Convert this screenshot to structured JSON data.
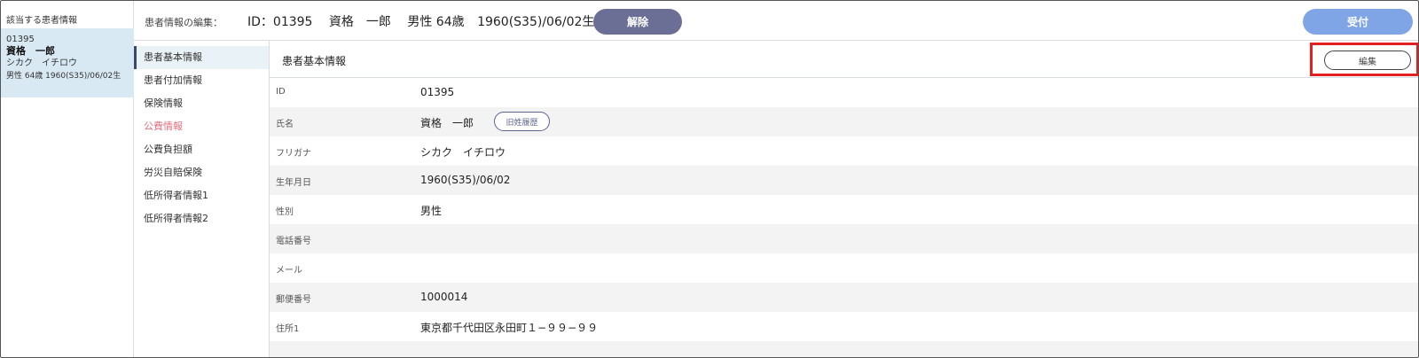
{
  "patient_panel": {
    "title": "該当する患者情報",
    "card": {
      "id": "01395",
      "name": "資格　一郎",
      "kana": "シカク　イチロウ",
      "info": "男性 64歳 1960(S35)/06/02生"
    }
  },
  "header": {
    "label": "患者情報の編集：",
    "id_text": "ID：01395",
    "name": "資格　一郎",
    "sex_age": "男性 64歳",
    "birth": "1960(S35)/06/02生",
    "release_label": "解除",
    "accept_label": "受付"
  },
  "sidenav": {
    "items": [
      {
        "label": "患者基本情報"
      },
      {
        "label": "患者付加情報"
      },
      {
        "label": "保険情報"
      },
      {
        "label": "公費情報"
      },
      {
        "label": "公費負担額"
      },
      {
        "label": "労災自賠保険"
      },
      {
        "label": "低所得者情報1"
      },
      {
        "label": "低所得者情報2"
      }
    ]
  },
  "main": {
    "section_title": "患者基本情報",
    "edit_label": "編集",
    "history_label": "旧姓履歴",
    "rows": [
      {
        "label": "ID",
        "value": "01395"
      },
      {
        "label": "氏名",
        "value": "資格　一郎"
      },
      {
        "label": "フリガナ",
        "value": "シカク　イチロウ"
      },
      {
        "label": "生年月日",
        "value": "1960(S35)/06/02"
      },
      {
        "label": "性別",
        "value": "男性"
      },
      {
        "label": "電話番号",
        "value": ""
      },
      {
        "label": "メール",
        "value": ""
      },
      {
        "label": "郵便番号",
        "value": "1000014"
      },
      {
        "label": "住所1",
        "value": "東京都千代田区永田町１−９９−９９"
      }
    ]
  },
  "colors": {
    "release_button": "#6b6f96",
    "accept_button": "#7fa5e6",
    "highlight": "#e32020",
    "alert_nav": "#e0707c",
    "patient_card_bg": "#d9e9f4"
  }
}
